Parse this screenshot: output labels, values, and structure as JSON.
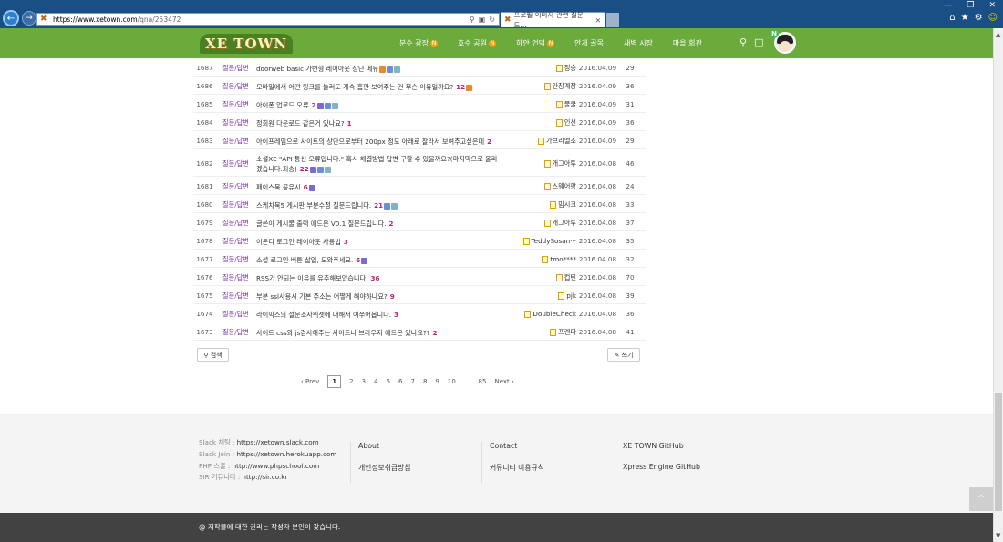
{
  "browser": {
    "url_host": "https://www.xetown.com",
    "url_path": "/qna/253472",
    "tab_title": "프로필 이미지 관련 질문드..."
  },
  "site": {
    "logo": "XE TOWN",
    "nav": [
      {
        "label": "분수 광장",
        "badge": "N"
      },
      {
        "label": "호수 공원",
        "badge": "N"
      },
      {
        "label": "하얀 언덕",
        "badge": "N"
      },
      {
        "label": "안개 골목",
        "badge": ""
      },
      {
        "label": "새벽 시장",
        "badge": ""
      },
      {
        "label": "마을 회관",
        "badge": ""
      }
    ],
    "notification_badge": "N"
  },
  "board": {
    "rows": [
      {
        "no": "1687",
        "cat": "질문/답변",
        "title": "doorweb basic 가변형 레이아웃 상단 메뉴",
        "cmt": "",
        "marks": [
          "f",
          "i",
          "a"
        ],
        "author": "정승",
        "date": "2016.04.09",
        "views": "29"
      },
      {
        "no": "1686",
        "cat": "질문/답변",
        "title": "모바일에서 어떤 링크를 눌러도 계속 홈판 보여주는 건 무슨 이유일까요?",
        "cmt": "12",
        "marks": [
          "f"
        ],
        "author": "간장계장",
        "date": "2016.04.09",
        "views": "36"
      },
      {
        "no": "1685",
        "cat": "질문/답변",
        "title": "아이폰 업로드 오류",
        "cmt": "2",
        "marks": [
          "u",
          "i",
          "a"
        ],
        "author": "물쿨",
        "date": "2016.04.09",
        "views": "31"
      },
      {
        "no": "1684",
        "cat": "질문/답변",
        "title": "정회원 다운로드 같은거 있나요?",
        "cmt": "1",
        "marks": [],
        "author": "인선",
        "date": "2016.04.09",
        "views": "36"
      },
      {
        "no": "1683",
        "cat": "질문/답변",
        "title": "아이프레임으로 사이트의 상단으로부터 200px 정도 아래로 잘라서 보여주고싶은데",
        "cmt": "2",
        "marks": [],
        "author": "가브리엘조",
        "date": "2016.04.09",
        "views": "29"
      },
      {
        "no": "1682",
        "cat": "질문/답변",
        "title": "소셜XE \"API 통신 오류입니다.\" 혹시 해결방법 답변 구할 수 있을까요?(마지막으로 올리겠습니다.죄송)",
        "cmt": "22",
        "marks": [
          "u",
          "i",
          "a"
        ],
        "author": "개그아투",
        "date": "2016.04.08",
        "views": "46",
        "tall": true
      },
      {
        "no": "1681",
        "cat": "질문/답변",
        "title": "페이스북 공유시",
        "cmt": "6",
        "marks": [
          "u"
        ],
        "author": "스웨어팡",
        "date": "2016.04.08",
        "views": "24"
      },
      {
        "no": "1680",
        "cat": "질문/답변",
        "title": "스케치북5 게시판 부분수정 질문드립니다.",
        "cmt": "21",
        "marks": [
          "i",
          "a"
        ],
        "author": "밈시크",
        "date": "2016.04.08",
        "views": "33"
      },
      {
        "no": "1679",
        "cat": "질문/답변",
        "title": "글쓴이 게시물 출력 애드온 V0.1 질문드립니다.",
        "cmt": "2",
        "marks": [],
        "author": "개그아투",
        "date": "2016.04.08",
        "views": "37"
      },
      {
        "no": "1678",
        "cat": "질문/답변",
        "title": "이온디 로그인 레이아웃 사용법",
        "cmt": "3",
        "marks": [],
        "author": "TeddySosan···",
        "date": "2016.04.08",
        "views": "35"
      },
      {
        "no": "1677",
        "cat": "질문/답변",
        "title": "소셜 로그인 버튼 삽입, 도와주세요.",
        "cmt": "6",
        "marks": [
          "u"
        ],
        "author": "tmo****",
        "date": "2016.04.08",
        "views": "32"
      },
      {
        "no": "1676",
        "cat": "질문/답변",
        "title": "RSS가 안되는 이유를 유추해보았습니다.",
        "cmt": "36",
        "marks": [],
        "author": "컵틴",
        "date": "2016.04.08",
        "views": "70"
      },
      {
        "no": "1675",
        "cat": "질문/답변",
        "title": "부분 ssl사용시 기본 주소는 어떻게 해야하나요?",
        "cmt": "9",
        "marks": [],
        "author": "pjk",
        "date": "2016.04.08",
        "views": "39"
      },
      {
        "no": "1674",
        "cat": "질문/답변",
        "title": "라이믹스의 설문조사위젯에 대해서 여쭈어봅니다.",
        "cmt": "3",
        "marks": [],
        "author": "DoubleCheck",
        "date": "2016.04.08",
        "views": "36"
      },
      {
        "no": "1673",
        "cat": "질문/답변",
        "title": "사이트 css와 js검사해주는 사이트나 브라우저 애드온 있나요??",
        "cmt": "2",
        "marks": [],
        "author": "프렌다",
        "date": "2016.04.08",
        "views": "41"
      }
    ],
    "search_label": "검색",
    "write_label": "쓰기"
  },
  "pager": {
    "prev": "‹ Prev",
    "pages": [
      "1",
      "2",
      "3",
      "4",
      "5",
      "6",
      "7",
      "8",
      "9",
      "10",
      "...",
      "85"
    ],
    "current": "1",
    "next": "Next ›"
  },
  "footer": {
    "links": [
      {
        "label": "Slack 채팅 : ",
        "value": "https://xetown.slack.com"
      },
      {
        "label": "Slack Join : ",
        "value": "https://xetown.herokuapp.com"
      },
      {
        "label": "PHP 스쿨 : ",
        "value": "http://www.phpschool.com"
      },
      {
        "label": "SIR 커뮤니티 : ",
        "value": "http://sir.co.kr"
      }
    ],
    "col1": [
      "About",
      "개인정보취급방침"
    ],
    "col2": [
      "Contact",
      "커뮤니티 이용규칙"
    ],
    "col3": [
      "XE TOWN GitHub",
      "Xpress Engine GitHub"
    ],
    "copyright": "@ 저작물에 대한 권리는 작성자 본인이 갖습니다."
  }
}
